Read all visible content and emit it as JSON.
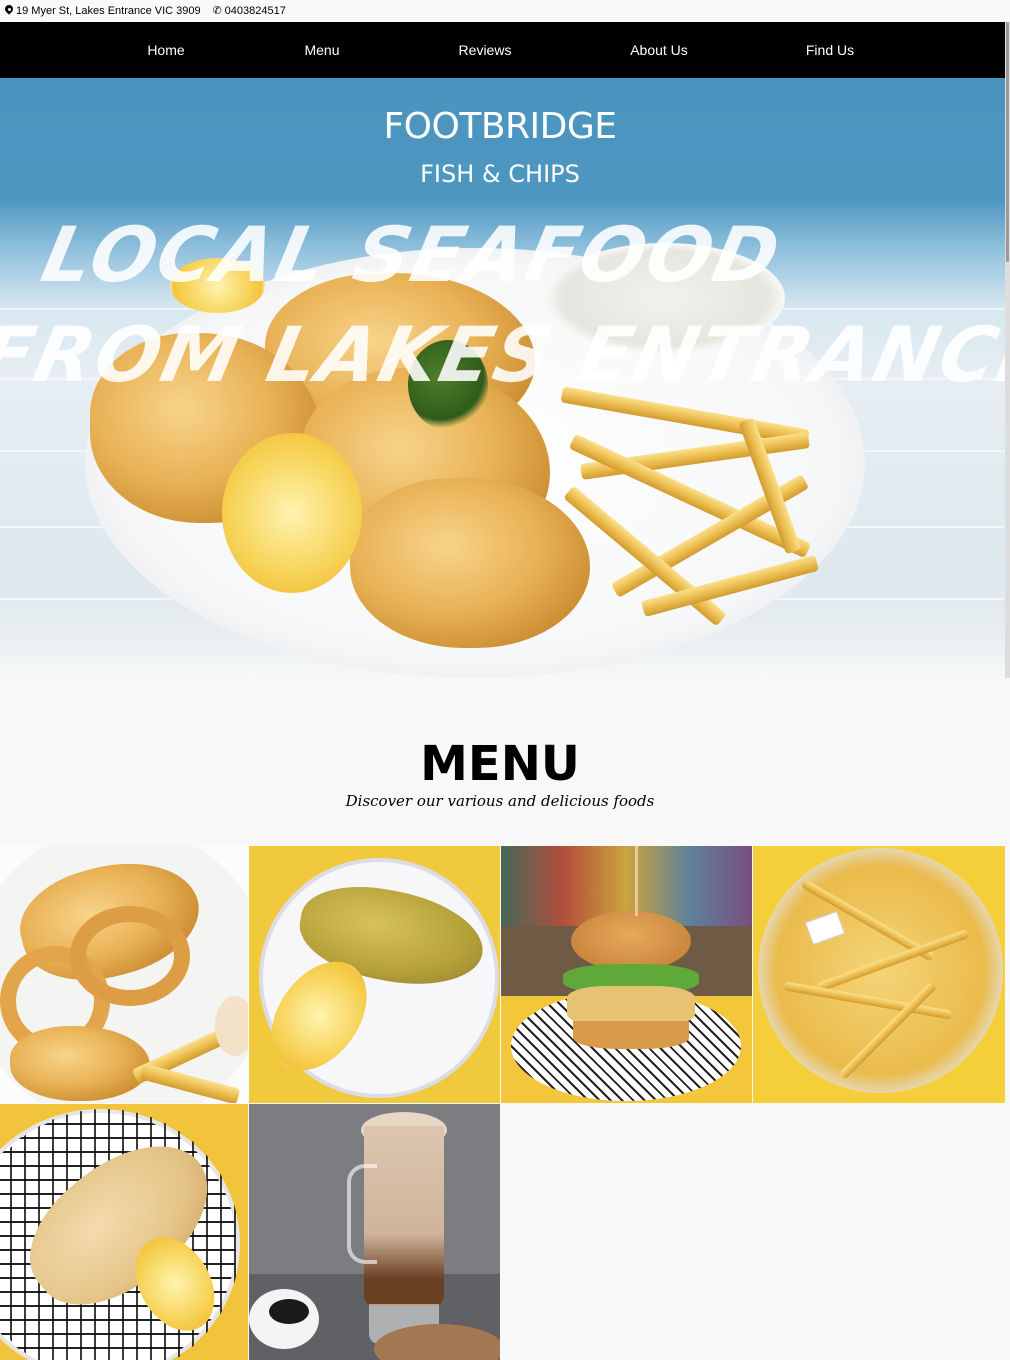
{
  "topbar": {
    "address": "19 Myer St, Lakes Entrance VIC 3909",
    "phone": "0403824517",
    "icons": [
      "map-pin-icon",
      "phone-icon"
    ]
  },
  "nav": {
    "items": [
      {
        "label": "Home"
      },
      {
        "label": "Menu"
      },
      {
        "label": "Reviews"
      },
      {
        "label": "About Us"
      },
      {
        "label": "Find Us"
      }
    ]
  },
  "hero": {
    "brand_line1": "FOOTBRIDGE",
    "brand_line2": "FISH & CHIPS",
    "slogan_line1": "LOCAL SEAFOOD",
    "slogan_line2": "FROM LAKES ENTRANCE"
  },
  "menu": {
    "title": "MENU",
    "subtitle": "Discover our various and delicious foods"
  },
  "colors": {
    "nav_bg": "#000000",
    "hero_blue": "#4a94bf",
    "page_bg": "#f8f8f8",
    "accent_yellow": "#f2c43b"
  }
}
